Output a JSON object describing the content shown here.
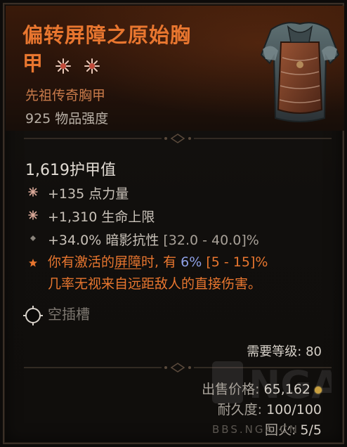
{
  "item": {
    "name_line1": "偏转屏障之原始胸",
    "name_line2": "甲",
    "type": "先祖传奇胸甲",
    "power": "925 物品强度",
    "armor_value": "1,619护甲值"
  },
  "affixes": [
    {
      "text": "+135 点力量",
      "range": "",
      "icon": "star-burst-icon"
    },
    {
      "text": "+1,310 生命上限",
      "range": "",
      "icon": "star-burst-icon"
    },
    {
      "text": "+34.0% 暗影抗性 ",
      "range": "[32.0 - 40.0]%",
      "icon": "diamond-icon"
    }
  ],
  "legendary": {
    "part1": "你有激活的",
    "underlined": "屏障",
    "part2": "时, 有 ",
    "percent": "6%",
    "range": " [5 - 15]%",
    "line2": "几率无视来自远距敌人的直接伤害。"
  },
  "socket": {
    "label": "空插槽"
  },
  "requirements": {
    "level_label": "需要等级: 80"
  },
  "footer": {
    "sell_label": "出售价格:",
    "sell_value": "65,162",
    "durability_label": "耐久度:",
    "durability_value": "100/100",
    "reroll_label": "回火:",
    "reroll_value": "5/5"
  },
  "watermark": {
    "site": "BBS.NGA.CN"
  },
  "colors": {
    "legendary_orange": "#e8762f",
    "header_bg": "#3a1a0a",
    "percent_blue": "#8ea0e6",
    "panel_bg": "#110f0d"
  }
}
